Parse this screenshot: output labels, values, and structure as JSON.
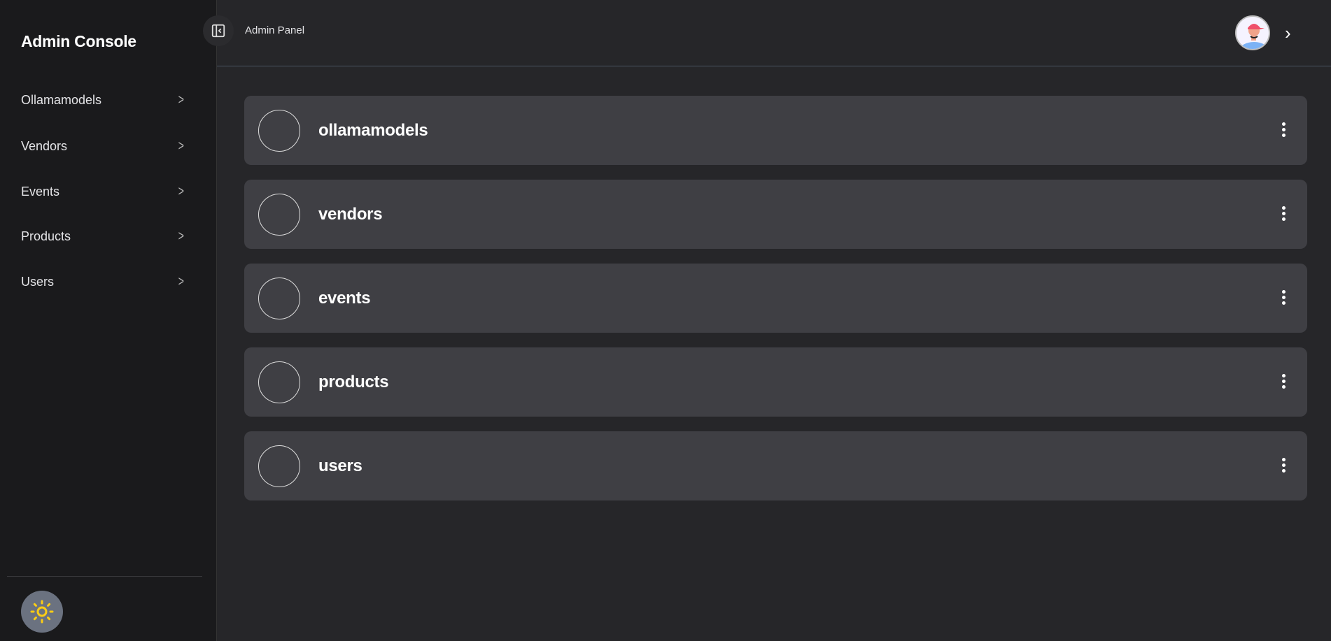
{
  "sidebar": {
    "title": "Admin Console",
    "items": [
      {
        "label": "Ollamamodels"
      },
      {
        "label": "Vendors"
      },
      {
        "label": "Events"
      },
      {
        "label": "Products"
      },
      {
        "label": "Users"
      }
    ],
    "theme_icon": "sun-icon",
    "theme_icon_color": "#facc15"
  },
  "header": {
    "breadcrumb": "Admin Panel"
  },
  "main": {
    "cards": [
      {
        "title": "ollamamodels"
      },
      {
        "title": "vendors"
      },
      {
        "title": "events"
      },
      {
        "title": "products"
      },
      {
        "title": "users"
      }
    ]
  }
}
